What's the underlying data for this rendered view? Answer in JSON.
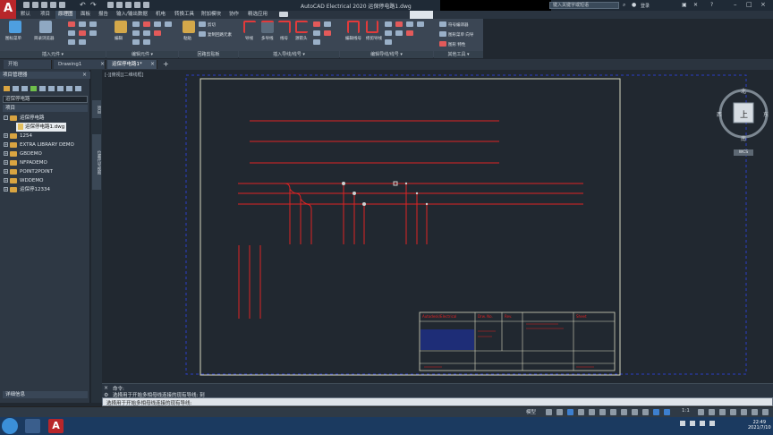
{
  "window": {
    "title": "AutoCAD Electrical 2020    运保停电路1.dwg",
    "search_placeholder": "键入关键字或短语",
    "user": "登录"
  },
  "app_button": "A",
  "ribbon_tabs": [
    "默认",
    "项目",
    "原理图",
    "面板",
    "报告",
    "输入/输出数据",
    "机电",
    "转换工具",
    "附加模块",
    "协作",
    "精选应用"
  ],
  "ribbon_active_tab": "原理图",
  "ribbon": {
    "insert_panel": {
      "title": "插入元件 ▾",
      "btn1": "图标菜单",
      "btn2": "目录浏览器"
    },
    "edit_panel": {
      "title": "编辑元件 ▾",
      "btn1": "编辑"
    },
    "circuit_panel": {
      "title": "回路剪贴板",
      "btn1": "粘贴",
      "small1": "剪切",
      "small2": "复制回路元素"
    },
    "wire_panel": {
      "title": "插入导线/线号 ▾",
      "btn1": "导线",
      "btn2": "多导线",
      "btn3": "线号",
      "btn4": "源箭头"
    },
    "edit_wire_panel": {
      "title": "编辑导线/线号 ▾",
      "btn1": "编辑线号",
      "btn2": "修剪导线"
    },
    "other_panel": {
      "title": "其他工具 ▾",
      "small1": "符号编译器",
      "small2": "图形菜单 向导",
      "small3": "图形 特性"
    }
  },
  "doc_tabs": [
    {
      "label": "开始",
      "active": false
    },
    {
      "label": "Drawing1",
      "active": false
    },
    {
      "label": "运保停电路1*",
      "active": true
    }
  ],
  "project_manager": {
    "title": "项目管理器",
    "project_name": "运保停电路",
    "section": "项目",
    "tree": [
      {
        "label": "运保停电路",
        "kind": "project"
      },
      {
        "label": "运保停电路1.dwg",
        "kind": "drawing"
      },
      {
        "label": "1254",
        "kind": "project"
      },
      {
        "label": "EXTRA LIBRARY DEMO",
        "kind": "project"
      },
      {
        "label": "GBDEMO",
        "kind": "project"
      },
      {
        "label": "NFPADEMO",
        "kind": "project"
      },
      {
        "label": "POINT2POINT",
        "kind": "project"
      },
      {
        "label": "WDDEMO",
        "kind": "project"
      },
      {
        "label": "运保停12334",
        "kind": "project"
      }
    ],
    "details_label": "详细信息"
  },
  "side_tabs": [
    "项目",
    "位置代号视图"
  ],
  "viewport": {
    "label": "[-][俯视][二维线框]"
  },
  "viewcube": {
    "north": "北",
    "south": "南",
    "east": "东",
    "west": "西",
    "face": "上",
    "wcs": "WCS"
  },
  "command": {
    "line1": "命令:",
    "line2": "选择用于开始多相母线连接的现有导线:  刻",
    "prompt": "选择用于开始多相母线连接的现有导线:"
  },
  "statusbar": {
    "model": "模型",
    "scale": "1:1"
  },
  "clock": {
    "time": "22:49",
    "date": "2021/7/10"
  },
  "title_block": {
    "row1a": "Autodesk/Electrical",
    "row1b": "Drw. No.",
    "row1c": "Rev.",
    "row1d": "Sheet"
  },
  "colors": {
    "wire": "#e02323",
    "border": "#d8d8c0",
    "accent": "#3d7fcf"
  }
}
